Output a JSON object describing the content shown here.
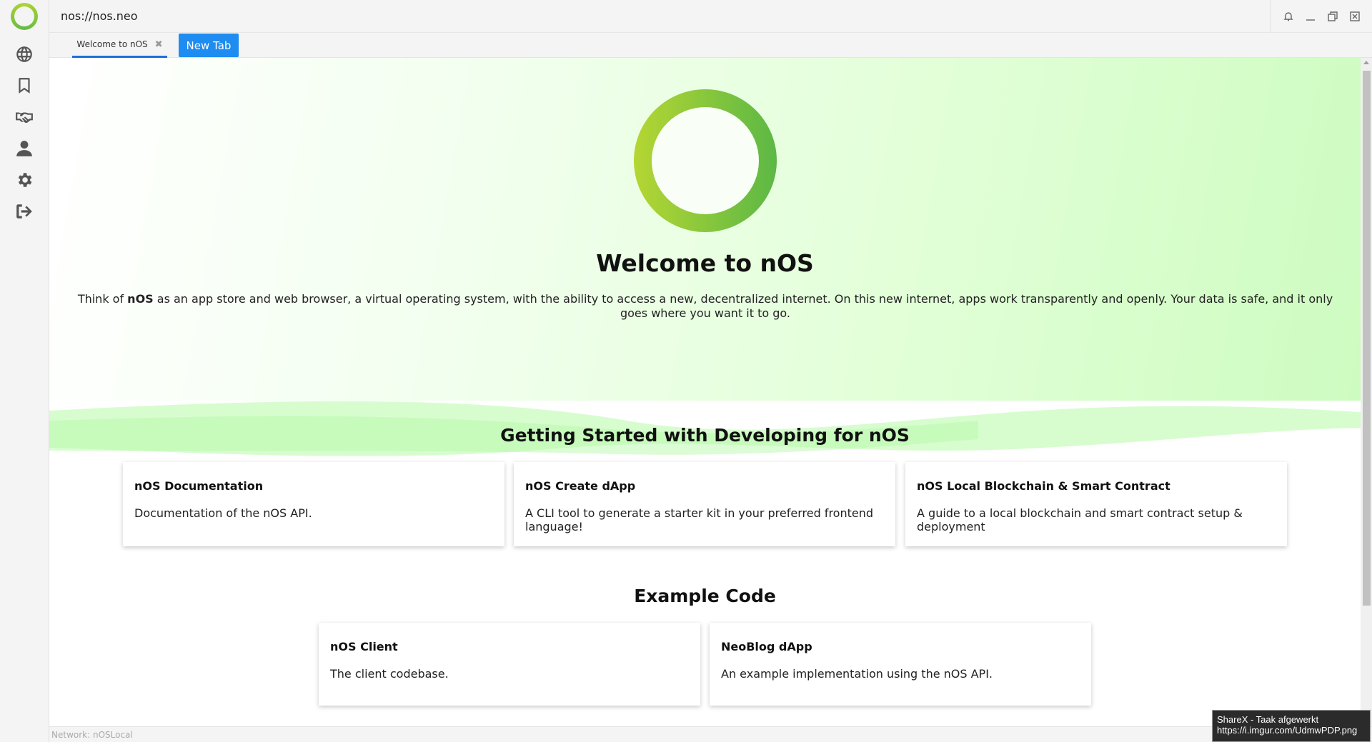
{
  "app": {
    "address": "nos://nos.neo"
  },
  "sidebar": {
    "items": [
      {
        "name": "browser",
        "icon": "globe-icon"
      },
      {
        "name": "favorites",
        "icon": "bookmark-icon"
      },
      {
        "name": "exchange",
        "icon": "handshake-icon"
      },
      {
        "name": "account",
        "icon": "user-icon"
      },
      {
        "name": "settings",
        "icon": "gear-icon"
      },
      {
        "name": "logout",
        "icon": "logout-icon"
      }
    ]
  },
  "window_controls": {
    "icons": [
      "bell-icon",
      "minimize-icon",
      "maximize-icon",
      "close-icon"
    ]
  },
  "tabs": {
    "active_label": "Welcome to nOS",
    "close_symbol": "✖",
    "new_tab_label": "New Tab"
  },
  "hero": {
    "title": "Welcome to nOS",
    "text_prefix": "Think of ",
    "text_bold": "nOS",
    "text_suffix": " as an app store and web browser, a virtual operating system, with the ability to access a new, decentralized internet. On this new internet, apps work transparently and openly. Your data is safe, and it only goes where you want it to go."
  },
  "getting_started": {
    "title": "Getting Started with Developing for nOS",
    "cards": [
      {
        "title": "nOS Documentation",
        "description": "Documentation of the nOS API."
      },
      {
        "title": "nOS Create dApp",
        "description": "A CLI tool to generate a starter kit in your preferred frontend language!"
      },
      {
        "title": "nOS Local Blockchain & Smart Contract",
        "description": "A guide to a local blockchain and smart contract setup & deployment"
      }
    ]
  },
  "example_code": {
    "title": "Example Code",
    "cards": [
      {
        "title": "nOS Client",
        "description": "The client codebase."
      },
      {
        "title": "NeoBlog dApp",
        "description": "An example implementation using the nOS API."
      }
    ]
  },
  "status": {
    "network": "Network: nOSLocal"
  },
  "toast": {
    "line1": "ShareX - Taak afgewerkt",
    "line2": "https://i.imgur.com/UdmwPDP.png"
  },
  "colors": {
    "accent_blue": "#1e8cf0",
    "ring_start": "#b5d633",
    "ring_end": "#5cb845"
  }
}
